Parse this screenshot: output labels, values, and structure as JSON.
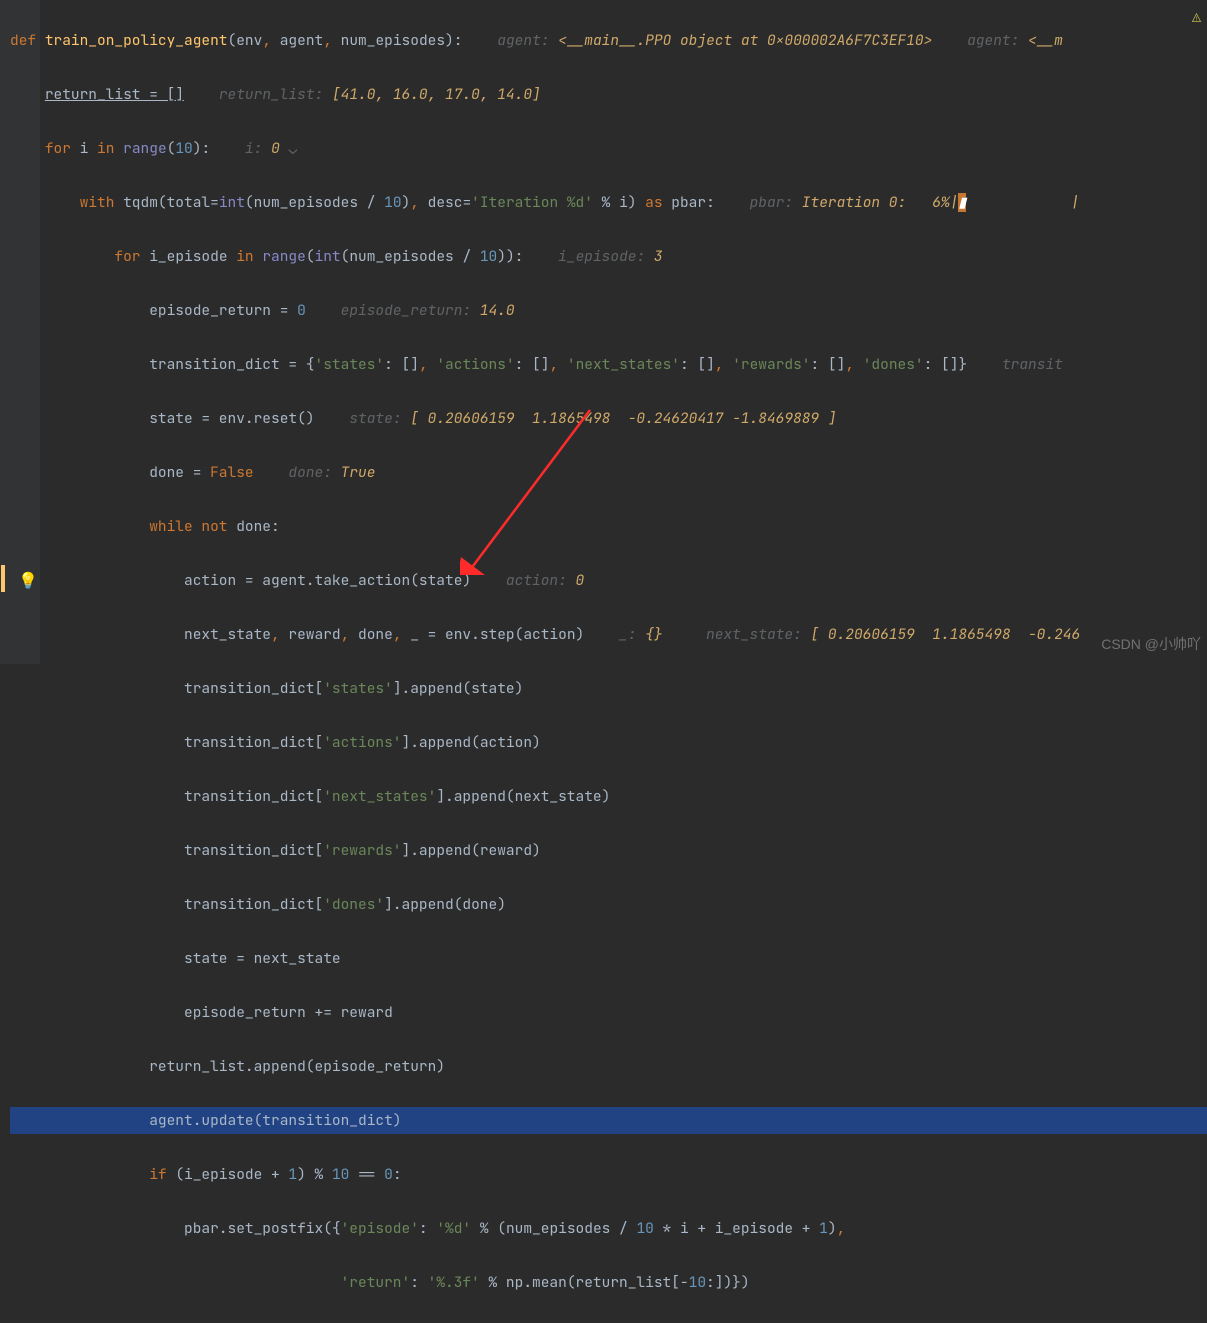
{
  "line1": {
    "def": "def ",
    "fname": "train_on_policy_agent",
    "params": "(env",
    "c1": ", ",
    "p2": "agent",
    "c2": ", ",
    "p3": "num_episodes):",
    "gap": "    ",
    "hint1a": "agent: ",
    "hint1b": "<__main__.PPO object at 0x000002A6F7C3EF10>",
    "gap2": "    ",
    "hint2a": "agent: ",
    "hint2b": "<__m"
  },
  "line2": {
    "indent": "    ",
    "text": "return_list = []",
    "gap": "    ",
    "hinta": "return_list: ",
    "hintb": "[41.0, 16.0, 17.0, 14.0]"
  },
  "line3": {
    "indent": "    ",
    "for": "for ",
    "i": "i ",
    "in": "in ",
    "range": "range",
    "args": "(",
    "ten": "10",
    "close": "):",
    "gap": "    ",
    "hinta": "i: ",
    "hintb": "0"
  },
  "line4": {
    "indent": "        ",
    "with": "with ",
    "tqdm": "tqdm(",
    "total": "total",
    "eq": "=",
    "int": "int",
    "open": "(num_episodes / ",
    "ten": "10",
    "close1": ")",
    "c1": ", ",
    "desc": "desc",
    "eq2": "=",
    "str": "'Iteration %d'",
    "mod": " % i) ",
    "as": "as ",
    "pbar": "pbar:",
    "gap": "    ",
    "hinta": "pbar: ",
    "hintb": "Iteration 0:   6%|",
    "hintc": "            | "
  },
  "line5": {
    "indent": "            ",
    "for": "for ",
    "var": "i_episode ",
    "in": "in ",
    "range": "range",
    "open": "(",
    "int": "int",
    "args": "(num_episodes / ",
    "ten": "10",
    "close": ")):",
    "gap": "    ",
    "hinta": "i_episode: ",
    "hintb": "3"
  },
  "line6": {
    "indent": "                ",
    "text1": "episode_return = ",
    "zero": "0",
    "gap": "    ",
    "hinta": "episode_return: ",
    "hintb": "14.0"
  },
  "line7": {
    "indent": "                ",
    "text1": "transition_dict = {",
    "k1": "'states'",
    "v1": ": []",
    "c1": ", ",
    "k2": "'actions'",
    "v2": ": []",
    "c2": ", ",
    "k3": "'next_states'",
    "v3": ": []",
    "c3": ", ",
    "k4": "'rewards'",
    "v4": ": []",
    "c4": ", ",
    "k5": "'dones'",
    "v5": ": []}",
    "gap": "    ",
    "hinta": "transit"
  },
  "line8": {
    "indent": "                ",
    "text": "state = env.reset()",
    "gap": "    ",
    "hinta": "state: ",
    "hintb": "[ 0.20606159  1.1865498  -0.24620417 -1.8469889 ]"
  },
  "line9": {
    "indent": "                ",
    "text": "done = ",
    "false": "False",
    "gap": "    ",
    "hinta": "done: ",
    "hintb": "True"
  },
  "line10": {
    "indent": "                ",
    "while": "while not ",
    "text": "done:"
  },
  "line11": {
    "indent": "                    ",
    "text": "action = agent.take_action(state)",
    "gap": "    ",
    "hinta": "action: ",
    "hintb": "0"
  },
  "line12": {
    "indent": "                    ",
    "text1": "next_state",
    "c1": ", ",
    "text2": "reward",
    "c2": ", ",
    "text3": "done",
    "c3": ", ",
    "text4": "_ = env.step(action)",
    "gap": "    ",
    "hinta": "_: ",
    "hintb": "{}",
    "gap2": "     ",
    "hintc": "next_state: ",
    "hintd": "[ 0.20606159  1.1865498  -0.246"
  },
  "line13": {
    "indent": "                    ",
    "text1": "transition_dict[",
    "key": "'states'",
    "text2": "].append(state)"
  },
  "line14": {
    "indent": "                    ",
    "text1": "transition_dict[",
    "key": "'actions'",
    "text2": "].append(action)"
  },
  "line15": {
    "indent": "                    ",
    "text1": "transition_dict[",
    "key": "'next_states'",
    "text2": "].append(next_state)"
  },
  "line16": {
    "indent": "                    ",
    "text1": "transition_dict[",
    "key": "'rewards'",
    "text2": "].append(reward)"
  },
  "line17": {
    "indent": "                    ",
    "text1": "transition_dict[",
    "key": "'dones'",
    "text2": "].append(done)"
  },
  "line18": {
    "indent": "                    ",
    "text": "state = next_state"
  },
  "line19": {
    "indent": "                    ",
    "text": "episode_return += reward"
  },
  "line20": {
    "indent": "                ",
    "text": "return_list.append(episode_return)"
  },
  "line21": {
    "indent": "                ",
    "text": "agent.update(transition_dict)"
  },
  "line22": {
    "indent": "                ",
    "if": "if ",
    "text1": "(i_episode + ",
    "one": "1",
    "text2": ") % ",
    "ten": "10",
    "text3": " == ",
    "zero": "0",
    "colon": ":"
  },
  "line23": {
    "indent": "                    ",
    "text1": "pbar.set_postfix({",
    "k1": "'episode'",
    "mid": ": ",
    "v1": "'%d'",
    "text2": " % (num_episodes / ",
    "ten": "10",
    "text3": " * i + i_episode + ",
    "one": "1",
    "close": ")",
    "comma": ","
  },
  "line24": {
    "indent": "                                      ",
    "k": "'return'",
    "mid": ": ",
    "v": "'%.3f'",
    "text": " % np.mean(return_list[-",
    "ten": "10",
    "close": ":])})"
  },
  "watermark": "CSDN @小帅吖",
  "bulb": "💡"
}
